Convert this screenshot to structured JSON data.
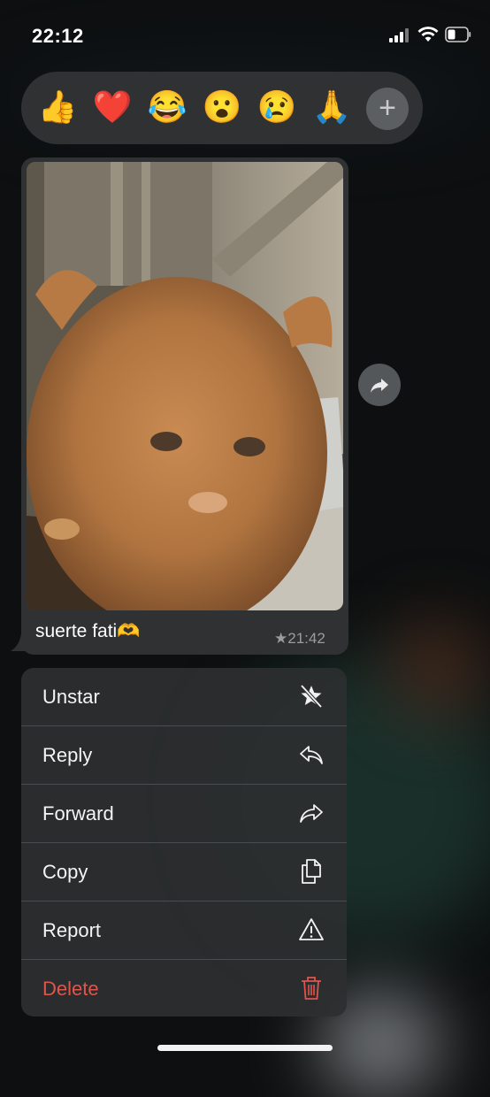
{
  "status_bar": {
    "time": "22:12"
  },
  "reactions": [
    {
      "icon": "thumbs-up-emoji",
      "glyph": "👍"
    },
    {
      "icon": "red-heart-emoji",
      "glyph": "❤️"
    },
    {
      "icon": "tears-of-joy-emoji",
      "glyph": "😂"
    },
    {
      "icon": "surprised-face-emoji",
      "glyph": "😮"
    },
    {
      "icon": "crying-face-emoji",
      "glyph": "😢"
    },
    {
      "icon": "folded-hands-emoji",
      "glyph": "🙏"
    }
  ],
  "add_reaction_glyph": "+",
  "message": {
    "caption": "suerte fati🫶",
    "meta": "★21:42"
  },
  "menu": {
    "items": [
      {
        "label": "Unstar",
        "icon": "unstar-icon"
      },
      {
        "label": "Reply",
        "icon": "reply-icon"
      },
      {
        "label": "Forward",
        "icon": "forward-icon"
      },
      {
        "label": "Copy",
        "icon": "copy-icon"
      },
      {
        "label": "Report",
        "icon": "warning-icon"
      },
      {
        "label": "Delete",
        "icon": "trash-icon"
      }
    ]
  },
  "colors": {
    "danger": "#e0544c",
    "bubble": "#2f3133",
    "menu": "#2c2f30"
  }
}
